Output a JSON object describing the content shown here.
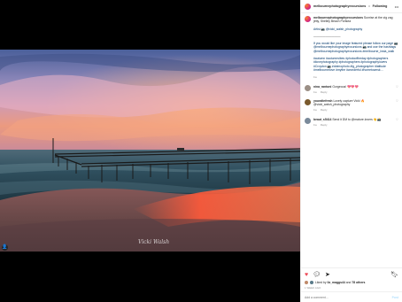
{
  "header": {
    "username": "melbournephotographyexcursions",
    "separator": "•",
    "follow_label": "Following",
    "more_icon": "more-dots-icon"
  },
  "caption": {
    "username": "melbournephotographyexcursions",
    "text": "Sunrise at the zig zag jetty, Shelley Beach Portsea",
    "artist": "Artist 📷 @vicki_walsh_photography",
    "divider": "—————————",
    "feature": "If you would like your image featured please follow our page 📷 @melbournephotographyexcursions 📷 and use the hashtags @melbournephotographyexcursions #melbourne_insta_walk",
    "tags": "#autumn #autumnvibes #photooftheday #photographers #ilovephotography #photographers #photographylovers #Croydon 📷 #dotmophoto #ig_photographer #latitude #melbournelove #mythe #wonderful #hometownsk…",
    "time": "1w"
  },
  "comments": [
    {
      "username": "nina_rantoni",
      "text": "Gorgeous! 💖💖💖",
      "time": "1w",
      "reply_label": "Reply",
      "avatar_color": "#9b8f86"
    },
    {
      "username": "youraltefresh",
      "text": "Lovely capture Vicki 🔥 @vicki_walsh_photography",
      "time": "1w",
      "reply_label": "Reply",
      "avatar_color": "#7a5a2e"
    },
    {
      "username": "beaut_s5414",
      "text": "Send it DM to @mature.lovers 👏📸",
      "time": "1w",
      "reply_label": "Reply",
      "avatar_color": "#7a8a9a"
    }
  ],
  "actions": {
    "like_icon": "heart-filled-icon",
    "comment_icon": "comment-icon",
    "share_icon": "share-icon",
    "save_icon": "bookmark-icon",
    "likes_prefix": "Liked by",
    "likes_user": "liz_maggs44",
    "likes_suffix": "and",
    "likes_count": "78 others",
    "date": "1 WEEK AGO",
    "comment_placeholder": "Add a comment…",
    "post_label": "Post"
  },
  "photo": {
    "signature": "Vicki Walsh",
    "tag_icon": "user-tag-icon"
  },
  "colors": {
    "accent_link": "#00376b",
    "like_red": "#ed4956",
    "post_disabled": "#b2dffc"
  }
}
